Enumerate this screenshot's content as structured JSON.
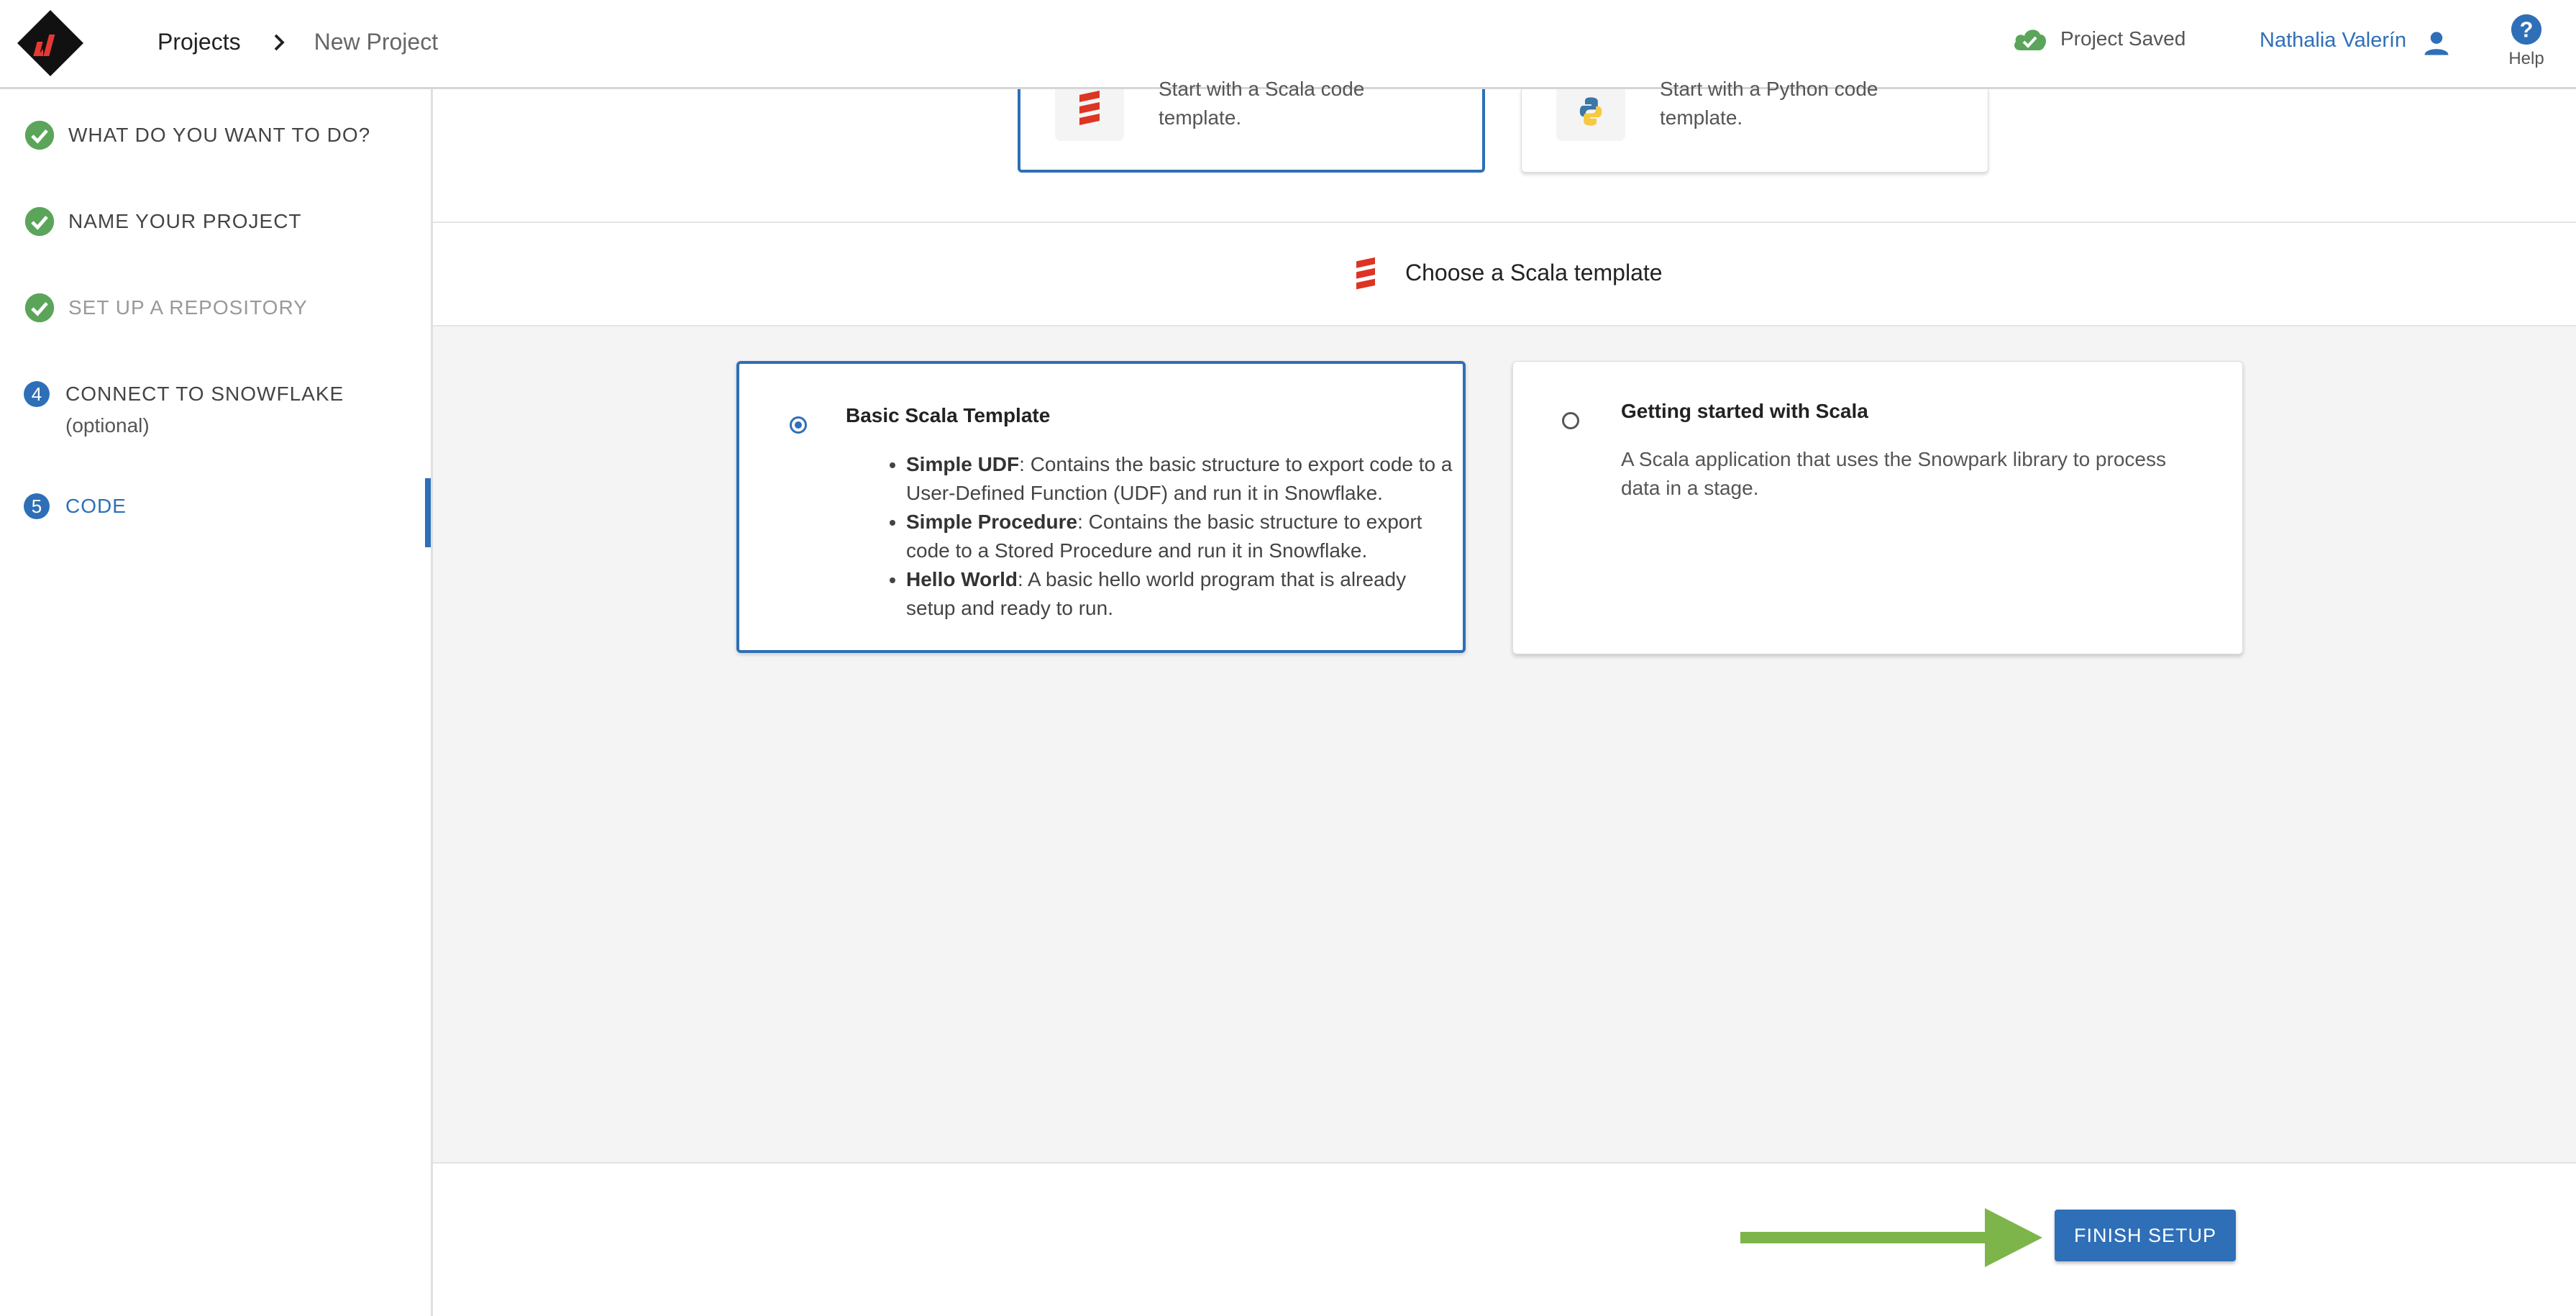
{
  "header": {
    "breadcrumb": {
      "root": "Projects",
      "current": "New Project"
    },
    "save_status": "Project Saved",
    "user_name": "Nathalia Valerín",
    "help_label": "Help"
  },
  "sidebar": {
    "steps": [
      {
        "label": "WHAT DO YOU WANT TO DO?",
        "state": "done"
      },
      {
        "label": "NAME YOUR PROJECT",
        "state": "done"
      },
      {
        "label": "SET UP A REPOSITORY",
        "state": "done-muted"
      },
      {
        "number": "4",
        "label": "CONNECT TO SNOWFLAKE",
        "sub": "(optional)",
        "state": "pending"
      },
      {
        "number": "5",
        "label": "CODE",
        "state": "active"
      }
    ]
  },
  "language_cards": {
    "scala": {
      "text": "Start with a Scala code template."
    },
    "python": {
      "text": "Start with a Python code template."
    }
  },
  "section": {
    "title": "Choose a Scala template"
  },
  "templates": [
    {
      "title": "Basic Scala Template",
      "selected": true,
      "items": [
        {
          "bold": "Simple UDF",
          "text": ": Contains the basic structure to export code to a User-Defined Function (UDF) and run it in Snowflake."
        },
        {
          "bold": "Simple Procedure",
          "text": ": Contains the basic structure to export code to a Stored Procedure and run it in Snowflake."
        },
        {
          "bold": "Hello World",
          "text": ": A basic hello world program that is already setup and ready to run."
        }
      ]
    },
    {
      "title": "Getting started with Scala",
      "selected": false,
      "description": "A Scala application that uses the Snowpark library to process data in a stage."
    }
  ],
  "footer": {
    "finish_label": "FINISH SETUP"
  },
  "colors": {
    "accent": "#2e6fb7",
    "success": "#5aa55a",
    "arrow": "#7db54a",
    "logo_red": "#e53935"
  },
  "icons": {
    "check": "check-circle-icon",
    "cloud": "cloud-check-icon",
    "user": "person-icon",
    "help": "help-circle-icon",
    "scala": "scala-logo-icon",
    "python": "python-logo-icon"
  }
}
